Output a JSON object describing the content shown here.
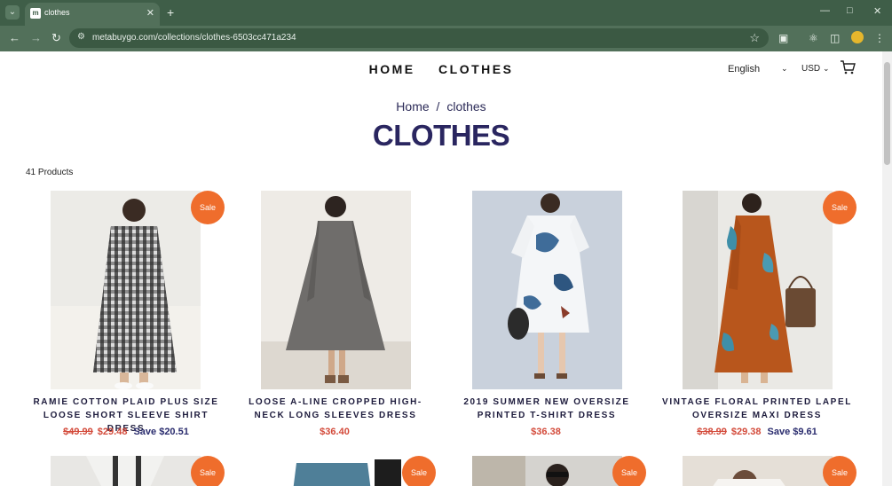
{
  "browser": {
    "tab_title": "clothes",
    "favicon_text": "m",
    "url": "metabuygo.com/collections/clothes-6503cc471a234",
    "profile_color": "#e5b62c"
  },
  "nav": {
    "home": "HOME",
    "clothes": "CLOTHES"
  },
  "locale": {
    "language": "English",
    "currency": "USD"
  },
  "breadcrumb": {
    "home": "Home",
    "sep": "/",
    "current": "clothes"
  },
  "page_title": "CLOTHES",
  "product_count": "41 Products",
  "sale_label": "Sale",
  "accent_color": "#ef6d2c",
  "products": [
    {
      "name": "RAMIE COTTON PLAID PLUS SIZE LOOSE SHORT SLEEVE SHIRT DRESS",
      "old_price": "$49.99",
      "price": "$29.48",
      "save": "Save $20.51"
    },
    {
      "name": "LOOSE A-LINE CROPPED HIGH-NECK LONG SLEEVES DRESS",
      "old_price": "",
      "price": "$36.40",
      "save": ""
    },
    {
      "name": "2019 SUMMER NEW OVERSIZE PRINTED T-SHIRT DRESS",
      "old_price": "",
      "price": "$36.38",
      "save": ""
    },
    {
      "name": "VINTAGE FLORAL PRINTED LAPEL OVERSIZE MAXI DRESS",
      "old_price": "$38.99",
      "price": "$29.38",
      "save": "Save $9.61"
    }
  ]
}
